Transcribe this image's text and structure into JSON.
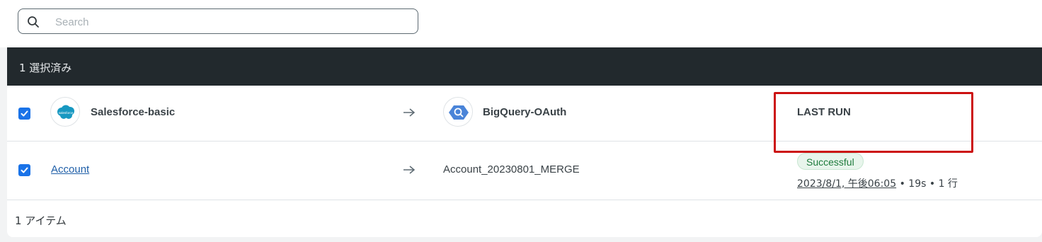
{
  "search": {
    "placeholder": "Search",
    "value": ""
  },
  "selection": {
    "label": "1 選択済み"
  },
  "header_row": {
    "checked": true,
    "source": {
      "name": "Salesforce-basic",
      "icon": "salesforce-logo-icon",
      "logo_text": "salesforce"
    },
    "destination": {
      "name": "BigQuery-OAuth",
      "icon": "bigquery-logo-icon"
    },
    "last_run_heading": "LAST RUN"
  },
  "rows": [
    {
      "checked": true,
      "object": "Account",
      "destination_table": "Account_20230801_MERGE",
      "status": "Successful",
      "run_time": "2023/8/1, 午後06:05",
      "duration": "19s",
      "row_count": "1 行"
    }
  ],
  "footer": {
    "item_count": "1 アイテム"
  },
  "colors": {
    "selection_bar": "#22292d",
    "checkbox": "#1a73e8",
    "link": "#1f5fa8",
    "success_text": "#1e7b3c",
    "success_bg": "#e8f5ec",
    "highlight": "#cc1111"
  }
}
